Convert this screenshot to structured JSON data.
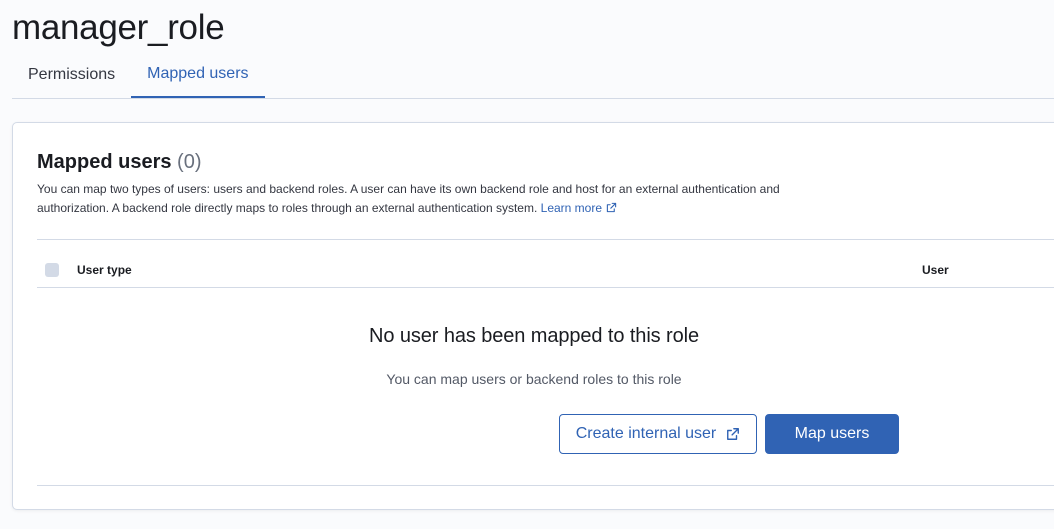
{
  "page": {
    "title": "manager_role"
  },
  "tabs": [
    {
      "label": "Permissions",
      "selected": false
    },
    {
      "label": "Mapped users",
      "selected": true
    }
  ],
  "panel": {
    "title": "Mapped users",
    "count": "(0)",
    "description": "You can map two types of users: users and backend roles. A user can have its own backend role and host for an external authentication and authorization. A backend role directly maps to roles through an external authentication system.",
    "learn_more": "Learn more"
  },
  "table": {
    "columns": [
      "User type",
      "User"
    ]
  },
  "empty_state": {
    "title": "No user has been mapped to this role",
    "subtitle": "You can map users or backend roles to this role",
    "create_button": "Create internal user",
    "map_button": "Map users"
  },
  "colors": {
    "accent": "#3063b4",
    "border": "#d3dae6",
    "background": "#fafbfd"
  }
}
